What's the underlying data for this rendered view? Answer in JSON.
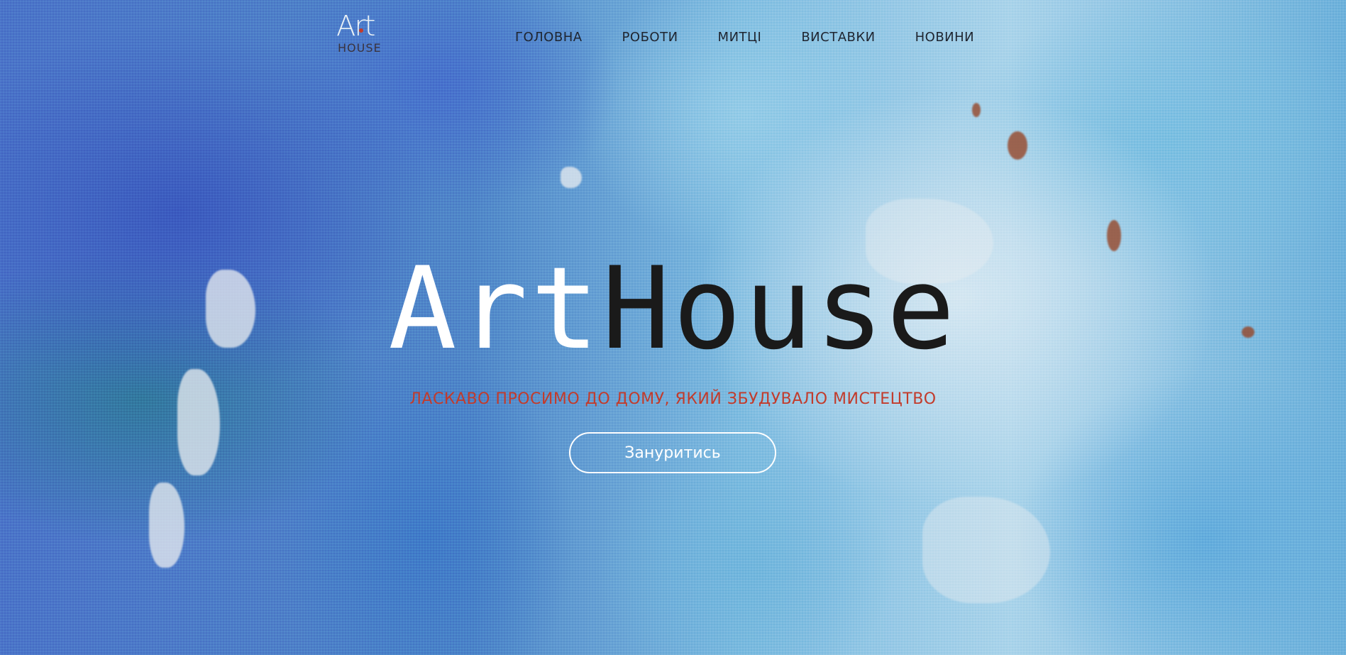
{
  "header": {
    "logo": {
      "line1": "Art",
      "line2": "HOUSE"
    },
    "nav": [
      {
        "label": "ГОЛОВНА"
      },
      {
        "label": "РОБОТИ"
      },
      {
        "label": "МИТЦІ"
      },
      {
        "label": "ВИСТАВКИ"
      },
      {
        "label": "НОВИНИ"
      }
    ]
  },
  "hero": {
    "title_part1": "Art",
    "title_part2": "House",
    "tagline": "ЛАСКАВО ПРОСИМО ДО ДОМУ, ЯКИЙ ЗБУДУВАЛО МИСТЕЦТВО",
    "cta_label": "Зануритись"
  },
  "colors": {
    "accent": "#c23b2b",
    "nav_text": "#1f2530",
    "title_light": "#ffffff",
    "title_dark": "#1a1a1a"
  }
}
